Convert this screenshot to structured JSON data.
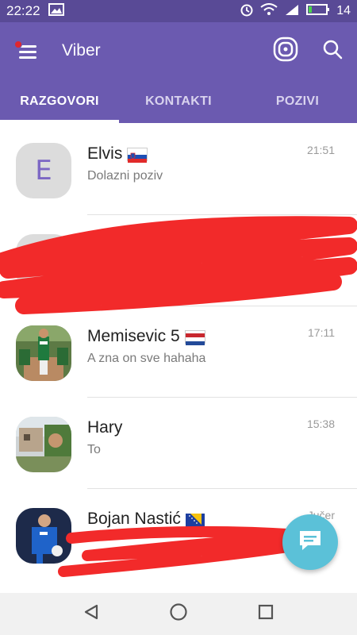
{
  "status_bar": {
    "time": "22:22",
    "battery_level": "14",
    "icons": [
      "gallery-icon",
      "alarm-icon",
      "wifi-icon",
      "signal-icon",
      "battery-icon"
    ]
  },
  "app_bar": {
    "title": "Viber",
    "actions": [
      "viber-out-icon",
      "search-icon"
    ]
  },
  "tabs": [
    {
      "label": "RAZGOVORI",
      "active": true
    },
    {
      "label": "KONTAKTI",
      "active": false
    },
    {
      "label": "POZIVI",
      "active": false
    }
  ],
  "conversations": [
    {
      "name": "Elvis",
      "preview": "Dolazni poziv",
      "time": "21:51",
      "avatar_letter": "E",
      "flag": "slovenia"
    },
    {
      "name": "",
      "preview": "",
      "time": "",
      "avatar_letter": "",
      "flag": ""
    },
    {
      "name": "Memisevic 5",
      "preview": "A zna on sve hahaha",
      "time": "17:11",
      "avatar_letter": "",
      "flag": "netherlands"
    },
    {
      "name": "Hary",
      "preview": "To",
      "time": "15:38",
      "avatar_letter": "",
      "flag": ""
    },
    {
      "name": "Bojan Nastić",
      "preview": "",
      "time": "Jučer",
      "avatar_letter": "",
      "flag": "bosnia"
    }
  ],
  "colors": {
    "status_bar": "#594a96",
    "app_bar": "#6b5ab0",
    "fab": "#5bc1d8",
    "scribble": "#f22a2a"
  }
}
